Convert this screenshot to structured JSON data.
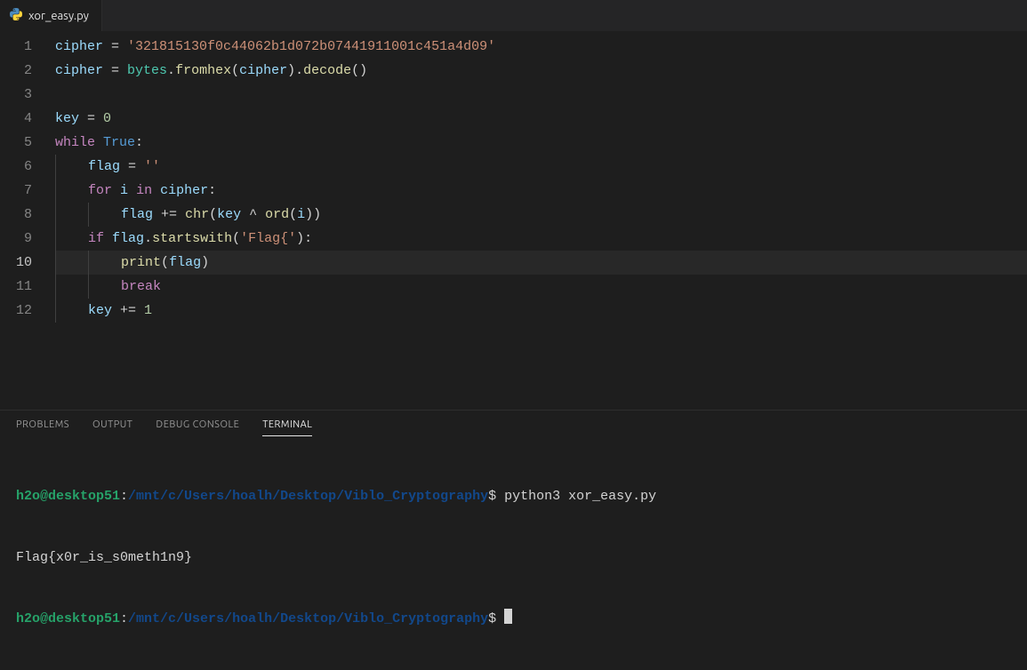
{
  "tab": {
    "file_name": "xor_easy.py",
    "icon_name": "python-file-icon"
  },
  "editor": {
    "line_numbers": [
      "1",
      "2",
      "3",
      "4",
      "5",
      "6",
      "7",
      "8",
      "9",
      "10",
      "11",
      "12"
    ],
    "active_line_index": 9,
    "tokens": {
      "l1": {
        "v_cipher": "cipher",
        "eq": " = ",
        "s": "'321815130f0c44062b1d072b07441911001c451a4d09'"
      },
      "l2": {
        "v_cipher": "cipher",
        "eq": " = ",
        "builtin": "bytes",
        "dot1": ".",
        "fn1": "fromhex",
        "p1": "(",
        "arg": "cipher",
        "p2": ").",
        "fn2": "decode",
        "p3": "()"
      },
      "l4": {
        "v": "key",
        "eq": " = ",
        "n": "0"
      },
      "l5": {
        "kw": "while",
        "sp": " ",
        "b": "True",
        "c": ":"
      },
      "l6": {
        "v": "flag",
        "eq": " = ",
        "s": "''"
      },
      "l7": {
        "kw_for": "for",
        "sp1": " ",
        "v": "i",
        "sp2": " ",
        "kw_in": "in",
        "sp3": " ",
        "it": "cipher",
        "c": ":"
      },
      "l8": {
        "v": "flag",
        "op": " += ",
        "fn1": "chr",
        "p1": "(",
        "a1": "key",
        "xor": " ^ ",
        "fn2": "ord",
        "p2": "(",
        "a2": "i",
        "p3": "))"
      },
      "l9": {
        "kw": "if",
        "sp": " ",
        "v": "flag",
        "dot": ".",
        "fn": "startswith",
        "p1": "(",
        "s": "'Flag{'",
        "p2": "):"
      },
      "l10": {
        "fn": "print",
        "p1": "(",
        "a": "flag",
        "p2": ")"
      },
      "l11": {
        "kw": "break"
      },
      "l12": {
        "v": "key",
        "op": " += ",
        "n": "1"
      }
    }
  },
  "panel": {
    "tabs": {
      "problems": "PROBLEMS",
      "output": "OUTPUT",
      "debug": "DEBUG CONSOLE",
      "terminal": "TERMINAL"
    },
    "active_tab": "terminal"
  },
  "terminal": {
    "line1": {
      "user": "h2o@desktop51",
      "colon": ":",
      "path": "/mnt/c/Users/hoalh/Desktop/Viblo_Cryptography",
      "prompt": "$ ",
      "cmd": "python3 xor_easy.py"
    },
    "line2": {
      "out": "Flag{x0r_is_s0meth1n9}"
    },
    "line3": {
      "user": "h2o@desktop51",
      "colon": ":",
      "path": "/mnt/c/Users/hoalh/Desktop/Viblo_Cryptography",
      "prompt": "$ "
    }
  }
}
